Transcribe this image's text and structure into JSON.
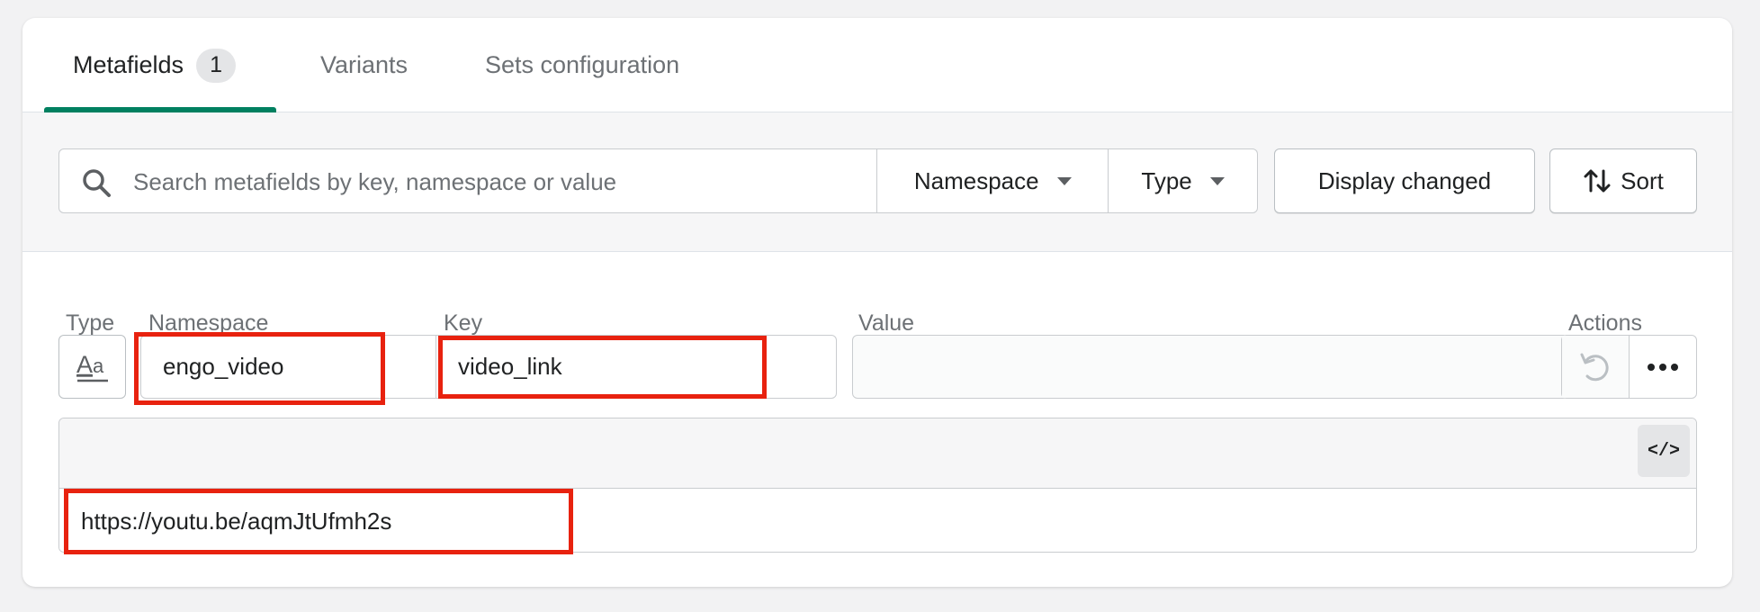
{
  "tabs": [
    {
      "label": "Metafields",
      "badge": "1",
      "active": true
    },
    {
      "label": "Variants",
      "active": false
    },
    {
      "label": "Sets configuration",
      "active": false
    }
  ],
  "filters": {
    "search_placeholder": "Search metafields by key, namespace or value",
    "namespace_label": "Namespace",
    "type_label": "Type",
    "display_changed_label": "Display changed",
    "sort_label": "Sort"
  },
  "columns": {
    "type": "Type",
    "namespace": "Namespace",
    "key": "Key",
    "value": "Value",
    "actions": "Actions"
  },
  "row": {
    "type_icon": "text-type-icon",
    "namespace": "engo_video",
    "key": "video_link",
    "value": ""
  },
  "editor": {
    "code_toggle": "</>",
    "content": "https://youtu.be/aqmJtUfmh2s"
  },
  "colors": {
    "accent": "#008060",
    "highlight": "#e8220f"
  }
}
